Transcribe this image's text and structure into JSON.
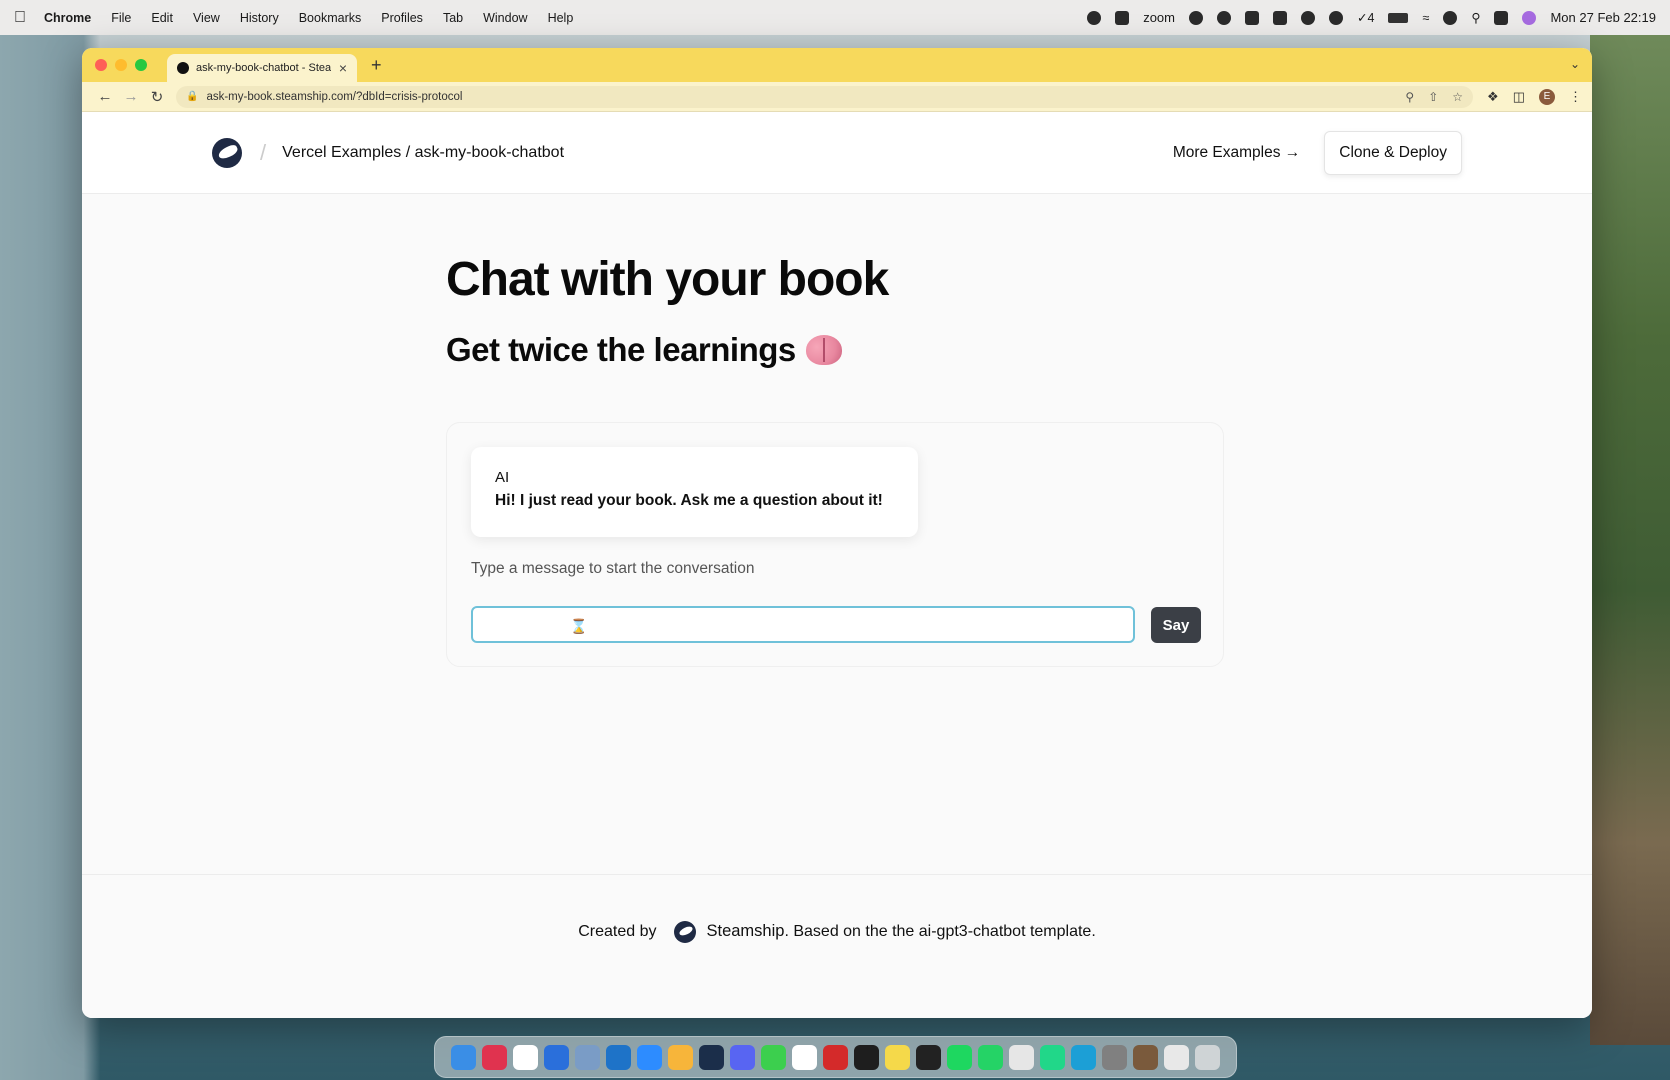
{
  "menubar": {
    "app_name": "Chrome",
    "menus": [
      "File",
      "Edit",
      "View",
      "History",
      "Bookmarks",
      "Profiles",
      "Tab",
      "Window",
      "Help"
    ],
    "zoom_label": "zoom",
    "tasks_count": "4",
    "datetime": "Mon 27 Feb  22:19"
  },
  "browser": {
    "tab_title": "ask-my-book-chatbot - Steamship",
    "url": "ask-my-book.steamship.com/?dbId=crisis-protocol",
    "profile_initial": "E"
  },
  "header": {
    "breadcrumb": "Vercel Examples / ask-my-book-chatbot",
    "more_examples": "More Examples →",
    "clone_deploy": "Clone & Deploy"
  },
  "hero": {
    "title": "Chat with your book",
    "subtitle": "Get twice the learnings"
  },
  "chat": {
    "messages": [
      {
        "sender": "AI",
        "text": "Hi! I just read your book. Ask me a question about it!"
      }
    ],
    "hint": "Type a message to start the conversation",
    "input_value": "",
    "send_label": "Say"
  },
  "footer": {
    "created_by": "Created by",
    "brand": "Steamship",
    "based_on": ". Based on the the ai-gpt3-chatbot template."
  },
  "dock": {
    "apps": [
      "finder",
      "slack",
      "tasks",
      "maps",
      "preview",
      "vscode",
      "zoom",
      "sketch",
      "app-cleaner",
      "discord",
      "messages",
      "notion",
      "acrobat",
      "terminal",
      "notes",
      "figma",
      "spotify",
      "whatsapp",
      "chrome",
      "pycharm",
      "webstorm",
      "system-settings",
      "archive",
      "document",
      "trash"
    ],
    "colors": [
      "#3a8ee6",
      "#e0334f",
      "#ffffff",
      "#2a6fdb",
      "#7a9cc6",
      "#1e73c8",
      "#2d8cff",
      "#f7b53a",
      "#1b2e4a",
      "#5865f2",
      "#3ccf4e",
      "#ffffff",
      "#d42a2a",
      "#1e1e1e",
      "#f5d94a",
      "#222222",
      "#1ed760",
      "#25d366",
      "#e6e6e6",
      "#21d789",
      "#1c9fd6",
      "#808080",
      "#7a5a3c",
      "#e8e8e8",
      "#cfd4d6"
    ]
  }
}
